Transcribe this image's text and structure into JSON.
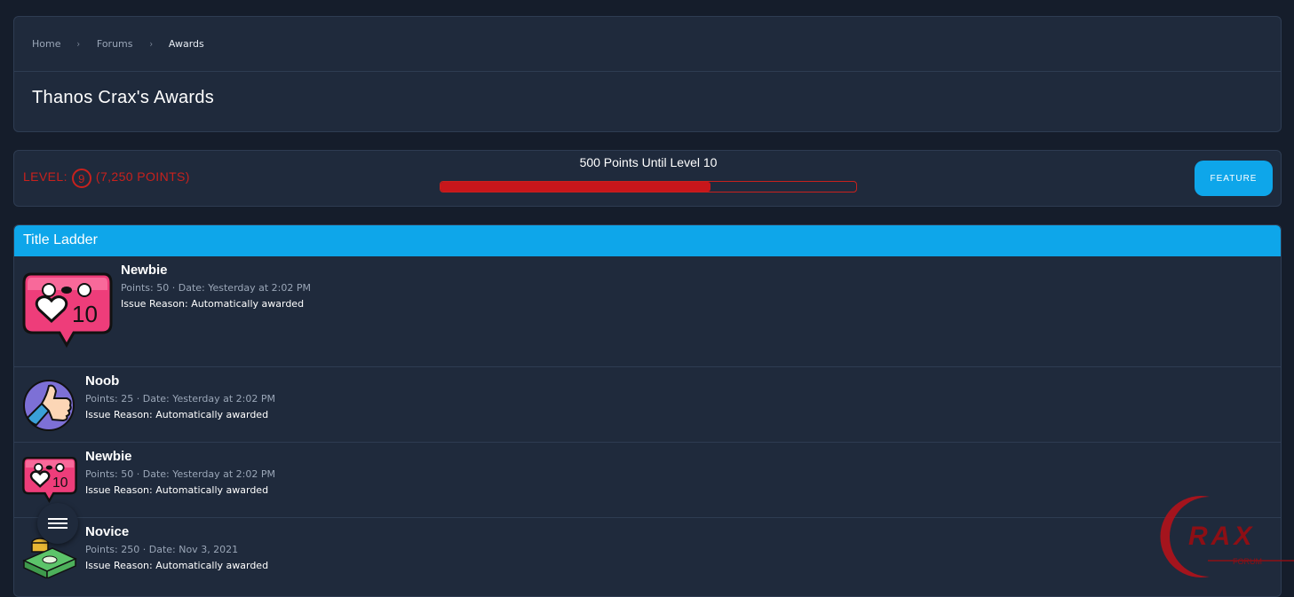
{
  "breadcrumb": {
    "items": [
      "Home",
      "Forums",
      "Awards"
    ],
    "separator": "›"
  },
  "page_title": "Thanos Crax's Awards",
  "level": {
    "label": "LEVEL:",
    "number": "9",
    "points": "(7,250 POINTS)",
    "until_text": "500 Points Until Level 10",
    "progress_fraction": 0.65,
    "feature_label": "FEATURE"
  },
  "ladder": {
    "title": "Title Ladder",
    "rows": [
      {
        "name": "Newbie",
        "meta": "Points: 50 · Date: Yesterday at 2:02 PM",
        "reason": "Issue Reason: Automatically awarded",
        "icon": "heart-10-badge-icon"
      },
      {
        "name": "Noob",
        "meta": "Points: 25 · Date: Yesterday at 2:02 PM",
        "reason": "Issue Reason: Automatically awarded",
        "icon": "thumbs-up-icon"
      },
      {
        "name": "Newbie",
        "meta": "Points: 50 · Date: Yesterday at 2:02 PM",
        "reason": "Issue Reason: Automatically awarded",
        "icon": "heart-10-badge-icon"
      },
      {
        "name": "Novice",
        "meta": "Points: 250 · Date: Nov 3, 2021",
        "reason": "Issue Reason: Automatically awarded",
        "icon": "money-stack-icon"
      }
    ]
  },
  "watermark": {
    "brand": "RAX",
    "sub": "FORUM"
  },
  "colors": {
    "accent": "#0ea6ea",
    "level_red": "#c8211d",
    "card_bg": "#1f2a3c",
    "page_bg": "#151d2b"
  }
}
